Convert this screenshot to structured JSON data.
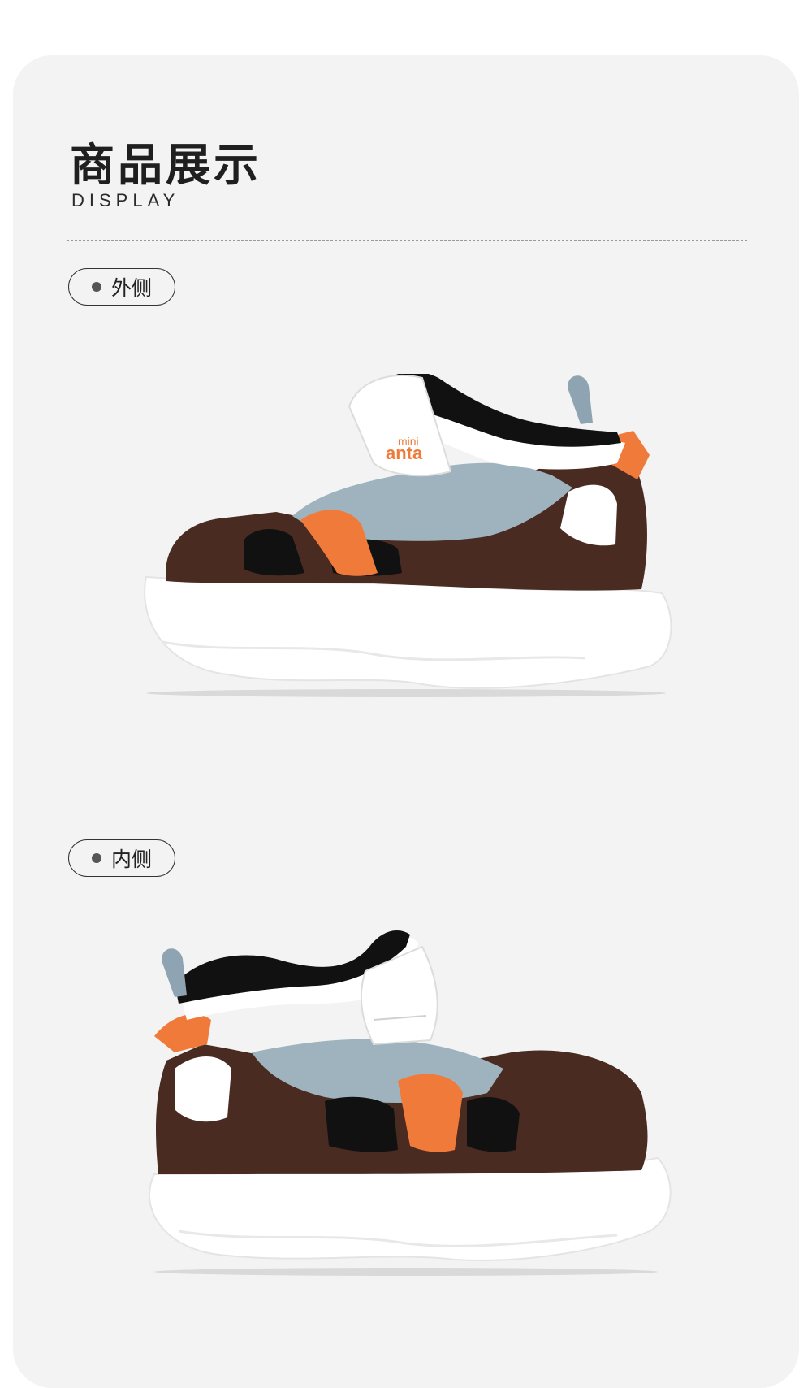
{
  "section": {
    "title": "商品展示",
    "subtitle": "DISPLAY"
  },
  "views": [
    {
      "label": "外侧"
    },
    {
      "label": "内侧"
    }
  ],
  "brand": {
    "line1": "mini",
    "line2": "anta"
  },
  "colors": {
    "background": "#f3f3f3",
    "brown": "#4a2b21",
    "orange": "#f07a3a",
    "blue_grey": "#9fb3bf",
    "sole": "#ffffff",
    "black": "#111111"
  }
}
